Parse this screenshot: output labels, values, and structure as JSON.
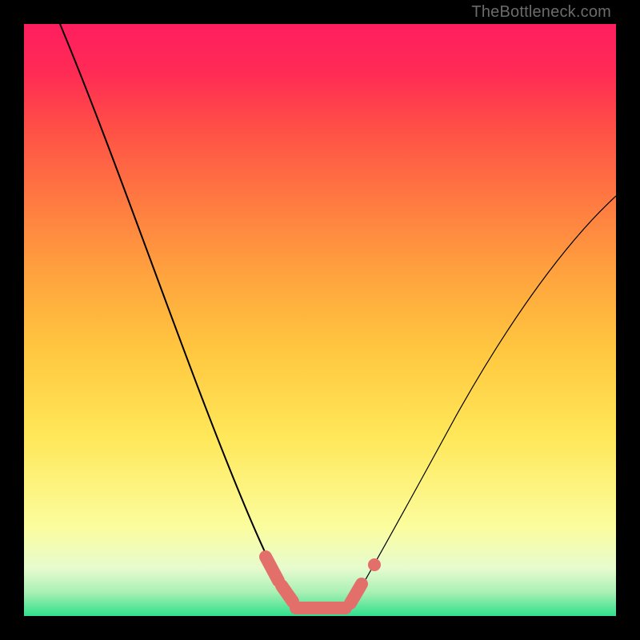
{
  "watermark": "TheBottleneck.com",
  "colors": {
    "gradient_top": "#ff1e5f",
    "gradient_bottom": "#2fe08c",
    "curve": "#000000",
    "highlight": "#e36f6a",
    "frame": "#000000"
  },
  "chart_data": {
    "type": "line",
    "title": "",
    "xlabel": "",
    "ylabel": "",
    "xlim": [
      0,
      100
    ],
    "ylim": [
      0,
      100
    ],
    "series": [
      {
        "name": "left-branch",
        "x": [
          5,
          10,
          15,
          20,
          25,
          30,
          35,
          38,
          40,
          42,
          44
        ],
        "y": [
          100,
          84,
          68,
          52,
          38,
          25,
          14,
          8,
          4,
          2,
          1
        ]
      },
      {
        "name": "valley-floor",
        "x": [
          44,
          46,
          48,
          50,
          52,
          54
        ],
        "y": [
          1,
          0.5,
          0.3,
          0.3,
          0.5,
          1
        ]
      },
      {
        "name": "right-branch",
        "x": [
          54,
          56,
          60,
          65,
          70,
          80,
          90,
          100
        ],
        "y": [
          1,
          2,
          6,
          12,
          20,
          36,
          52,
          68
        ]
      },
      {
        "name": "highlighted-region",
        "x": [
          40,
          42,
          44,
          46,
          48,
          50,
          52,
          54,
          56
        ],
        "y": [
          5,
          2.5,
          1.5,
          0.8,
          0.5,
          0.5,
          0.8,
          1.5,
          2.5
        ]
      }
    ],
    "annotations": [
      {
        "name": "highlight-dot",
        "x": 58,
        "y": 4
      }
    ]
  }
}
